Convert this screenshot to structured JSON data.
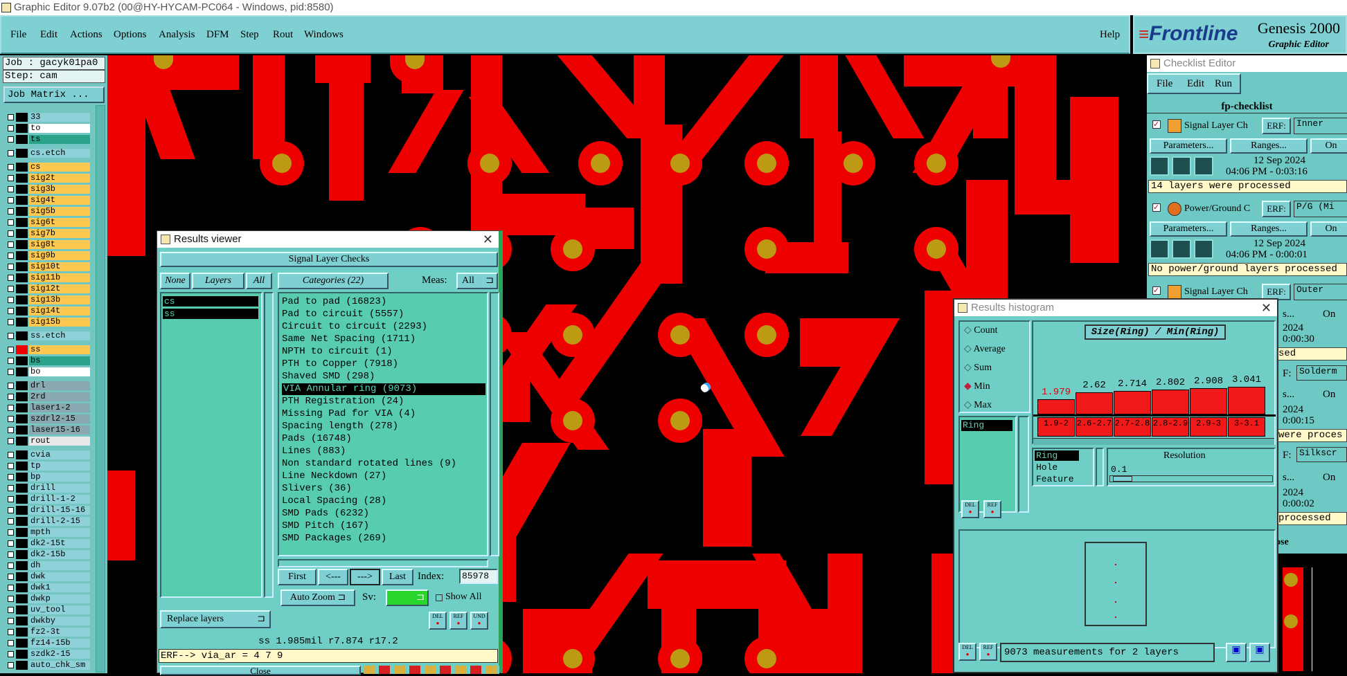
{
  "app": {
    "title": "Graphic Editor 9.07b2 (00@HY-HYCAM-PC064 - Windows, pid:8580)",
    "menu": [
      "File",
      "Edit",
      "Actions",
      "Options",
      "Analysis",
      "DFM",
      "Step",
      "Rout",
      "Windows"
    ],
    "help": "Help",
    "brand": {
      "logo": "Frontline",
      "product": "Genesis 2000",
      "subtitle": "Graphic Editor"
    }
  },
  "left_panel": {
    "job": "Job : gacyk01pa0",
    "step": "Step: cam",
    "job_matrix": "Job Matrix ...",
    "layers": [
      {
        "name": "33",
        "swatch": "#000000",
        "bg": "#8fd1d8"
      },
      {
        "name": "to",
        "swatch": "#000000",
        "bg": "#ffffff"
      },
      {
        "name": "ts",
        "swatch": "#000000",
        "bg": "#2ba38a"
      },
      {
        "name": "cs.etch",
        "swatch": "#000000",
        "bg": "#8fd1d8"
      },
      {
        "name": "cs",
        "swatch": "#000000",
        "bg": "#ffc851"
      },
      {
        "name": "sig2t",
        "swatch": "#000000",
        "bg": "#ffc851"
      },
      {
        "name": "sig3b",
        "swatch": "#000000",
        "bg": "#ffc851"
      },
      {
        "name": "sig4t",
        "swatch": "#000000",
        "bg": "#ffc851"
      },
      {
        "name": "sig5b",
        "swatch": "#000000",
        "bg": "#ffc851"
      },
      {
        "name": "sig6t",
        "swatch": "#000000",
        "bg": "#ffc851"
      },
      {
        "name": "sig7b",
        "swatch": "#000000",
        "bg": "#ffc851"
      },
      {
        "name": "sig8t",
        "swatch": "#000000",
        "bg": "#ffc851"
      },
      {
        "name": "sig9b",
        "swatch": "#000000",
        "bg": "#ffc851"
      },
      {
        "name": "sig10t",
        "swatch": "#000000",
        "bg": "#ffc851"
      },
      {
        "name": "sig11b",
        "swatch": "#000000",
        "bg": "#ffc851"
      },
      {
        "name": "sig12t",
        "swatch": "#000000",
        "bg": "#ffc851"
      },
      {
        "name": "sig13b",
        "swatch": "#000000",
        "bg": "#ffc851"
      },
      {
        "name": "sig14t",
        "swatch": "#000000",
        "bg": "#ffc851"
      },
      {
        "name": "sig15b",
        "swatch": "#000000",
        "bg": "#ffc851"
      },
      {
        "name": "ss.etch",
        "swatch": "#000000",
        "bg": "#8fd1d8"
      },
      {
        "name": "ss",
        "swatch": "#ee0000",
        "bg": "#ffc851"
      },
      {
        "name": "bs",
        "swatch": "#000000",
        "bg": "#2ba38a"
      },
      {
        "name": "bo",
        "swatch": "#000000",
        "bg": "#ffffff"
      },
      {
        "name": "drl",
        "swatch": "#000000",
        "bg": "#8aa8b0"
      },
      {
        "name": "2rd",
        "swatch": "#000000",
        "bg": "#8aa8b0"
      },
      {
        "name": "laser1-2",
        "swatch": "#000000",
        "bg": "#8aa8b0"
      },
      {
        "name": "szdrl2-15",
        "swatch": "#000000",
        "bg": "#8aa8b0"
      },
      {
        "name": "laser15-16",
        "swatch": "#000000",
        "bg": "#8aa8b0"
      },
      {
        "name": "rout",
        "swatch": "#000000",
        "bg": "#e8e8e8"
      },
      {
        "name": "cvia",
        "swatch": "#000000",
        "bg": "#8fd1d8"
      },
      {
        "name": "tp",
        "swatch": "#000000",
        "bg": "#8fd1d8"
      },
      {
        "name": "bp",
        "swatch": "#000000",
        "bg": "#8fd1d8"
      },
      {
        "name": "drill",
        "swatch": "#000000",
        "bg": "#8fd1d8"
      },
      {
        "name": "drill-1-2",
        "swatch": "#000000",
        "bg": "#8fd1d8"
      },
      {
        "name": "drill-15-16",
        "swatch": "#000000",
        "bg": "#8fd1d8"
      },
      {
        "name": "drill-2-15",
        "swatch": "#000000",
        "bg": "#8fd1d8"
      },
      {
        "name": "mpth",
        "swatch": "#000000",
        "bg": "#8fd1d8"
      },
      {
        "name": "dk2-15t",
        "swatch": "#000000",
        "bg": "#8fd1d8"
      },
      {
        "name": "dk2-15b",
        "swatch": "#000000",
        "bg": "#8fd1d8"
      },
      {
        "name": "dh",
        "swatch": "#000000",
        "bg": "#8fd1d8"
      },
      {
        "name": "dwk",
        "swatch": "#000000",
        "bg": "#8fd1d8"
      },
      {
        "name": "dwk1",
        "swatch": "#000000",
        "bg": "#8fd1d8"
      },
      {
        "name": "dwkp",
        "swatch": "#000000",
        "bg": "#8fd1d8"
      },
      {
        "name": "uv_tool",
        "swatch": "#000000",
        "bg": "#8fd1d8"
      },
      {
        "name": "dwkby",
        "swatch": "#000000",
        "bg": "#8fd1d8"
      },
      {
        "name": "fz2-3t",
        "swatch": "#000000",
        "bg": "#8fd1d8"
      },
      {
        "name": "fz14-15b",
        "swatch": "#000000",
        "bg": "#8fd1d8"
      },
      {
        "name": "szdk2-15",
        "swatch": "#000000",
        "bg": "#8fd1d8"
      },
      {
        "name": "auto_chk_sm",
        "swatch": "#000000",
        "bg": "#8fd1d8"
      }
    ]
  },
  "results_viewer": {
    "title": "Results viewer",
    "header": "Signal Layer Checks",
    "none": "None",
    "layers_label": "Layers",
    "all": "All",
    "categories_label": "Categories (22)",
    "meas_label": "Meas:",
    "meas_value": "All",
    "layers": [
      "cs",
      "ss"
    ],
    "categories": [
      "Pad to pad (16823)",
      "Pad to circuit (5557)",
      "Circuit to circuit (2293)",
      "Same Net Spacing (1711)",
      "NPTH to circuit (1)",
      "PTH to Copper (7918)",
      "Shaved SMD (298)",
      "VIA Annular ring (9073)",
      "PTH Registration (24)",
      "Missing Pad for VIA (4)",
      "Spacing length (278)",
      "Pads (16748)",
      "Lines (883)",
      "Non standard rotated lines (9)",
      "Line Neckdown (27)",
      "Slivers (36)",
      "Local Spacing (28)",
      "SMD Pads (6232)",
      "SMD Pitch (167)",
      "SMD Packages (269)"
    ],
    "selected_index": 7,
    "nav": {
      "first": "First",
      "prev": "<---",
      "next": "--->",
      "last": "Last",
      "index_label": "Index:",
      "index_value": "85978"
    },
    "auto_zoom": "Auto Zoom",
    "sv_label": "Sv:",
    "show_all": "Show All",
    "replace_layers": "Replace layers",
    "icons": [
      "DEL",
      "REF",
      "UND"
    ],
    "status": "ss 1.985mil  r7.874  r17.2",
    "erf": "ERF--> via_ar = 4 7 9",
    "close": "Close"
  },
  "histogram": {
    "title": "Results histogram",
    "modes": [
      "Count",
      "Average",
      "Sum",
      "Min",
      "Max"
    ],
    "selected_mode": "Min",
    "list_item": "Ring",
    "chart_title": "Size(Ring) / Min(Ring)",
    "bars": [
      {
        "value": "1.979",
        "range": "1.9-2",
        "color": "red"
      },
      {
        "value": "2.62",
        "range": "2.6-2.7"
      },
      {
        "value": "2.714",
        "range": "2.7-2.8"
      },
      {
        "value": "2.802",
        "range": "2.8-2.9"
      },
      {
        "value": "2.908",
        "range": "2.9-3"
      },
      {
        "value": "3.041",
        "range": "3-3.1"
      }
    ],
    "options": [
      "Ring",
      "Hole",
      "Feature"
    ],
    "resolution_label": "Resolution",
    "resolution_value": "0.1",
    "footer": "9073 measurements for 2 layers",
    "icons": [
      "DEL",
      "REF"
    ]
  },
  "checklist": {
    "title": "Checklist Editor",
    "menu": [
      "File",
      "Edit",
      "Run"
    ],
    "name": "fp-checklist",
    "items": [
      {
        "label": "Signal Layer Ch",
        "erf": "ERF:",
        "value": "Inner",
        "params": "Parameters...",
        "ranges": "Ranges...",
        "on": "On",
        "date": "12 Sep 2024",
        "time": "04:06 PM - 0:03:16",
        "msg": "14 layers were processed"
      },
      {
        "label": "Power/Ground C",
        "erf": "ERF:",
        "value": "P/G (Mi",
        "params": "Parameters...",
        "ranges": "Ranges...",
        "on": "On",
        "date": "12 Sep 2024",
        "time": "04:06 PM - 0:00:01",
        "msg": "No power/ground layers processed"
      },
      {
        "label": "Signal Layer Ch",
        "erf": "ERF:",
        "value": "Outer",
        "on": "On"
      }
    ],
    "hidden_fragments": [
      "s...",
      "2024",
      "0:00:30",
      "sed",
      "F:",
      "Solderm",
      "s...",
      "On",
      "2024",
      "0:00:15",
      "were proces",
      "F:",
      "Silkscr",
      "s...",
      "On",
      "2024",
      "0:00:02",
      "processed",
      "ose"
    ]
  }
}
